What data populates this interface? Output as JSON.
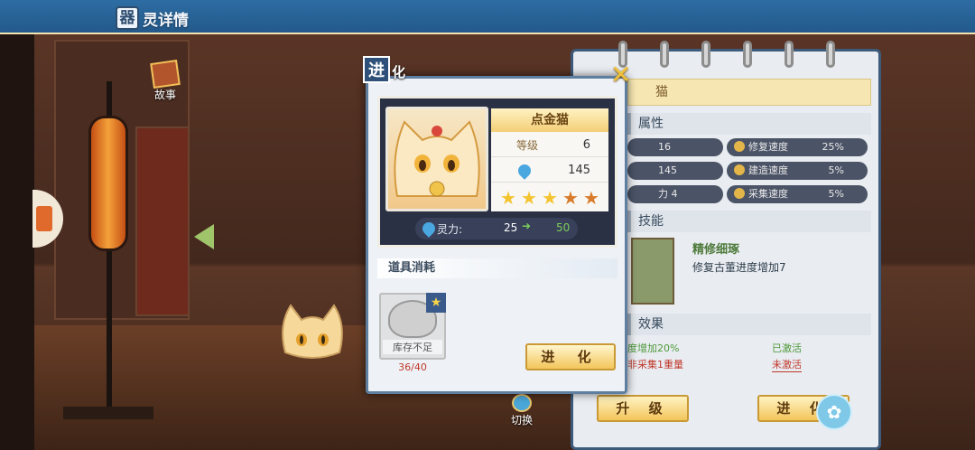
{
  "header": {
    "title_glyph": "器",
    "title_rest": "灵详情"
  },
  "story_button": {
    "label": "故事"
  },
  "switch_button": {
    "label": "切换"
  },
  "notebook": {
    "header_text": "猫",
    "attributes": {
      "section_label": "属性",
      "stats": [
        {
          "left_value": "16",
          "right_label": "修复速度",
          "right_value": "25%"
        },
        {
          "left_value": "145",
          "right_label": "建造速度",
          "right_value": "5%"
        },
        {
          "left_value": "力  4",
          "right_label": "采集速度",
          "right_value": "5%"
        }
      ]
    },
    "skill": {
      "section_label": "技能",
      "name": "精修细琢",
      "description": "修复古董进度增加7"
    },
    "effects": {
      "section_label": "效果",
      "rows": [
        {
          "text": "度增加20%",
          "status": "已激活"
        },
        {
          "text": "非采集1重量",
          "status": "未激活"
        }
      ]
    },
    "upgrade_label": "升 级",
    "evolve_label": "进 化"
  },
  "dialog": {
    "title_big": "进",
    "title_small": "化",
    "close_symbol": "✕",
    "name": "点金猫",
    "level_label": "等级",
    "level_value": "6",
    "spirit_value": "145",
    "stars": 5,
    "power_label": "灵力:",
    "power_from": "25",
    "power_arrow": "➜",
    "power_to": "50",
    "consume_section": "道具消耗",
    "item_stock_text": "库存不足",
    "item_count": "36/40",
    "evolve_label": "进 化"
  },
  "colors": {
    "accent_gold": "#f3c55b",
    "dialog_border": "#5f7fa0",
    "active_green": "#4d9a3a",
    "inactive_red": "#c0392b"
  }
}
